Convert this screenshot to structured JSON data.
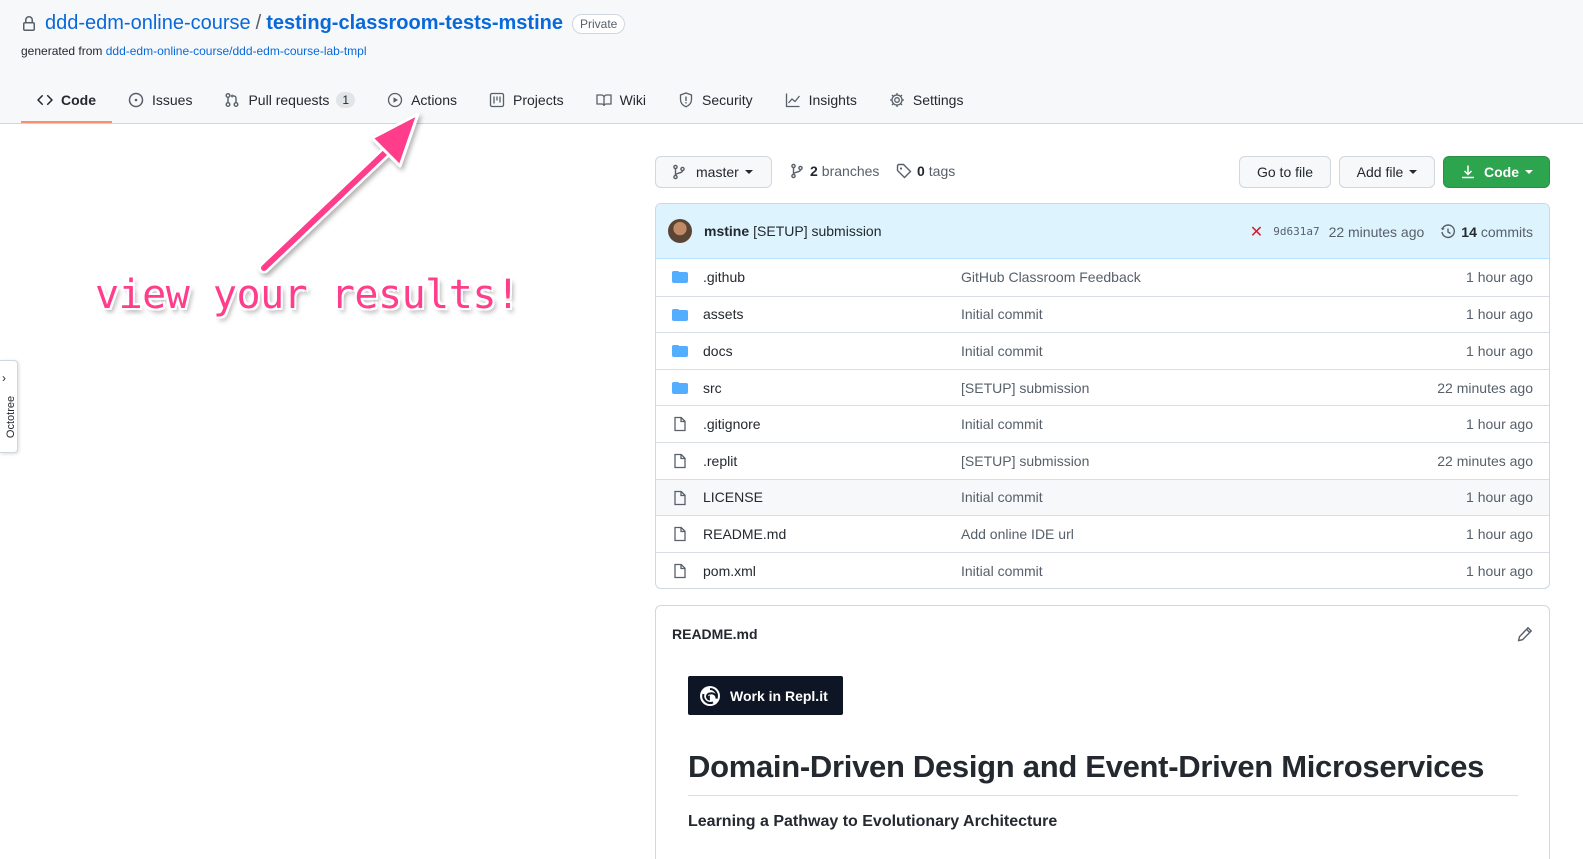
{
  "repo": {
    "owner": "ddd-edm-online-course",
    "separator": "/",
    "name": "testing-classroom-tests-mstine",
    "visibility": "Private",
    "generated_from_label": "generated from",
    "generated_from_link": "ddd-edm-online-course/ddd-edm-course-lab-tmpl"
  },
  "nav": {
    "tabs": [
      {
        "label": "Code",
        "icon": "code-icon",
        "selected": true
      },
      {
        "label": "Issues",
        "icon": "issue-icon"
      },
      {
        "label": "Pull requests",
        "icon": "pull-request-icon",
        "count": "1"
      },
      {
        "label": "Actions",
        "icon": "play-icon"
      },
      {
        "label": "Projects",
        "icon": "project-icon"
      },
      {
        "label": "Wiki",
        "icon": "book-icon"
      },
      {
        "label": "Security",
        "icon": "shield-icon"
      },
      {
        "label": "Insights",
        "icon": "graph-icon"
      },
      {
        "label": "Settings",
        "icon": "gear-icon"
      }
    ]
  },
  "octotree": {
    "label": "Octotree"
  },
  "annotation": {
    "text": "view your results!",
    "color": "#ff3d8b"
  },
  "toolbar": {
    "branch": "master",
    "branches_count": "2",
    "branches_label": "branches",
    "tags_count": "0",
    "tags_label": "tags",
    "goto_file": "Go to file",
    "add_file": "Add file",
    "code": "Code"
  },
  "commit": {
    "author": "mstine",
    "message": "[SETUP] submission",
    "sha": "9d631a7",
    "time": "22 minutes ago",
    "commits_count": "14",
    "commits_label": "commits",
    "status": "failed"
  },
  "files": [
    {
      "type": "dir",
      "name": ".github",
      "commit": "GitHub Classroom Feedback",
      "age": "1 hour ago"
    },
    {
      "type": "dir",
      "name": "assets",
      "commit": "Initial commit",
      "age": "1 hour ago"
    },
    {
      "type": "dir",
      "name": "docs",
      "commit": "Initial commit",
      "age": "1 hour ago"
    },
    {
      "type": "dir",
      "name": "src",
      "commit": "[SETUP] submission",
      "age": "22 minutes ago"
    },
    {
      "type": "file",
      "name": ".gitignore",
      "commit": "Initial commit",
      "age": "1 hour ago"
    },
    {
      "type": "file",
      "name": ".replit",
      "commit": "[SETUP] submission",
      "age": "22 minutes ago"
    },
    {
      "type": "file",
      "name": "LICENSE",
      "commit": "Initial commit",
      "age": "1 hour ago"
    },
    {
      "type": "file",
      "name": "README.md",
      "commit": "Add online IDE url",
      "age": "1 hour ago"
    },
    {
      "type": "file",
      "name": "pom.xml",
      "commit": "Initial commit",
      "age": "1 hour ago"
    }
  ],
  "readme": {
    "filename": "README.md",
    "badge_label": "Work in Repl.it",
    "title": "Domain-Driven Design and Event-Driven Microservices",
    "subtitle": "Learning a Pathway to Evolutionary Architecture"
  },
  "colors": {
    "link": "#0969da",
    "primary_button": "#2da44e",
    "selected_tab_underline": "#fd8c73",
    "folder": "#54aeff"
  }
}
